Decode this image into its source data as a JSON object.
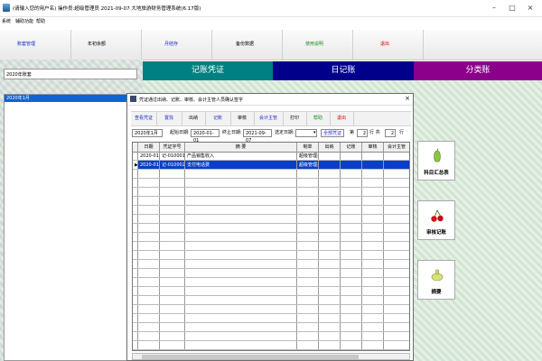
{
  "window": {
    "title": "(请输入您的用户名)   操作员:超级管理员   2021-09-07   大地旅游财务管理系统(6.17版)"
  },
  "menu": [
    "系统",
    "辅助功能",
    "帮助"
  ],
  "toolbar": [
    "账套管理",
    "年初余额",
    "月结存",
    "备份数据",
    "使用说明",
    "退出"
  ],
  "ledger": {
    "year": "2020年账套",
    "periods": [
      "2020年1月"
    ]
  },
  "tabs": [
    {
      "label": "记账凭证",
      "color": "#008080",
      "text_color": "#ffffff"
    },
    {
      "label": "日记账",
      "color": "#00008b",
      "text_color": "#ffffff"
    },
    {
      "label": "分类账",
      "color": "#8b008b",
      "text_color": "#ffffff"
    }
  ],
  "side_buttons": [
    {
      "label": "科目汇总表",
      "icon": "pepper-icon"
    },
    {
      "label": "审核记账",
      "icon": "cherries-icon"
    },
    {
      "label": "摘要",
      "icon": "bottle-icon"
    }
  ],
  "dialog": {
    "title": "凭证通过出纳、记账、审核、会计主管人员确认签字",
    "close": "×",
    "buttons": [
      "查看凭证",
      "置找",
      "出纳",
      "记账",
      "审核",
      "会计主管",
      "打印",
      "帮助",
      "退出"
    ],
    "filter": {
      "period": "2020年1月",
      "start_label": "起始日期:",
      "start": "2020-01-01",
      "end_label": "终止日期:",
      "end": "2021-09-07",
      "select_label": "选定日期:",
      "select_value": "",
      "all_label": "全部凭证",
      "page_prefix": "第",
      "page_value": "2",
      "page_row_label": "行 共",
      "page_total": "2",
      "page_suffix": "行"
    },
    "columns": [
      "日期",
      "凭证字号",
      "摘 要",
      "制单",
      "出纳",
      "记账",
      "审核",
      "会计主管"
    ],
    "rows": [
      {
        "date": "2020-01-16",
        "voucher": "记-010001",
        "summary": "产品销售收入",
        "maker": "超级管理员",
        "cashier": "",
        "bookkeeper": "",
        "auditor": "",
        "supervisor": "",
        "selected": false
      },
      {
        "date": "2020-01-16",
        "voucher": "记-010002",
        "summary": "支付电话费",
        "maker": "超级管理员",
        "cashier": "",
        "bookkeeper": "",
        "auditor": "",
        "supervisor": "",
        "selected": true
      }
    ]
  },
  "colors": {
    "toolbar_blue": "#1a2bd0",
    "toolbar_green": "#1a8a1a",
    "toolbar_red": "#cc0000",
    "select_blue": "#0a3ec8"
  }
}
